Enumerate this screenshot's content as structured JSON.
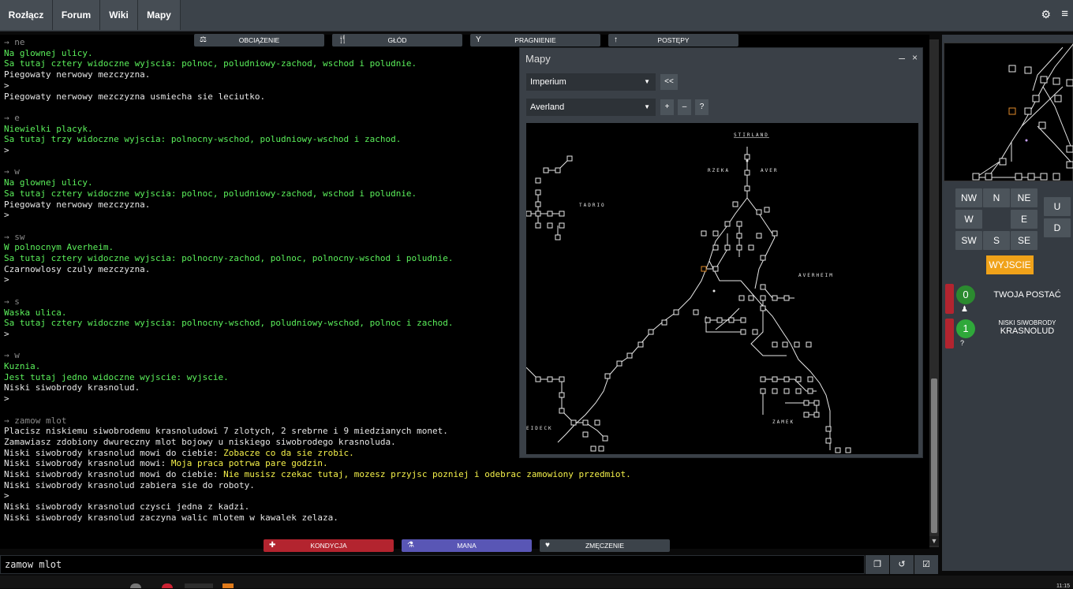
{
  "nav": {
    "disconnect": "Rozłącz",
    "forum": "Forum",
    "wiki": "Wiki",
    "maps": "Mapy"
  },
  "icons": {
    "settings": "gear-icon",
    "menu": "hamburger-icon"
  },
  "status_top": [
    {
      "label": "OBCIĄŻENIE",
      "icon": "scale-icon"
    },
    {
      "label": "GŁÓD",
      "icon": "fork-knife-icon"
    },
    {
      "label": "PRAGNIENIE",
      "icon": "cocktail-icon"
    },
    {
      "label": "POSTĘPY",
      "icon": "arrow-up-icon"
    }
  ],
  "status_bottom": [
    {
      "label": "KONDYCJA",
      "icon": "plus-icon",
      "color": "#b3242f"
    },
    {
      "label": "MANA",
      "icon": "flask-icon",
      "color": "#5956b5"
    },
    {
      "label": "ZMĘCZENIE",
      "icon": "heartbeat-icon",
      "color": "#3c434a"
    }
  ],
  "console_lines": [
    {
      "t": "→ ne",
      "c": "cmd"
    },
    {
      "t": "Na glownej ulicy.",
      "c": "grn"
    },
    {
      "t": "Sa tutaj cztery widoczne wyjscia: polnoc, poludniowy-zachod, wschod i poludnie.",
      "c": "grn"
    },
    {
      "t": "Piegowaty nerwowy mezczyzna.",
      "c": "wht"
    },
    {
      "t": ">",
      "c": "wht"
    },
    {
      "t": "Piegowaty nerwowy mezczyzna usmiecha sie leciutko.",
      "c": "wht"
    },
    {
      "t": "",
      "c": "wht"
    },
    {
      "t": "→ e",
      "c": "cmd"
    },
    {
      "t": "Niewielki placyk.",
      "c": "grn"
    },
    {
      "t": "Sa tutaj trzy widoczne wyjscia: polnocny-wschod, poludniowy-wschod i zachod.",
      "c": "grn"
    },
    {
      "t": ">",
      "c": "wht"
    },
    {
      "t": "",
      "c": "wht"
    },
    {
      "t": "→ w",
      "c": "cmd"
    },
    {
      "t": "Na glownej ulicy.",
      "c": "grn"
    },
    {
      "t": "Sa tutaj cztery widoczne wyjscia: polnoc, poludniowy-zachod, wschod i poludnie.",
      "c": "grn"
    },
    {
      "t": "Piegowaty nerwowy mezczyzna.",
      "c": "wht"
    },
    {
      "t": ">",
      "c": "wht"
    },
    {
      "t": "",
      "c": "wht"
    },
    {
      "t": "→ sw",
      "c": "cmd"
    },
    {
      "t": "W polnocnym Averheim.",
      "c": "grn"
    },
    {
      "t": "Sa tutaj cztery widoczne wyjscia: polnocny-zachod, polnoc, polnocny-wschod i poludnie.",
      "c": "grn"
    },
    {
      "t": "Czarnowlosy czuly mezczyzna.",
      "c": "wht"
    },
    {
      "t": ">",
      "c": "wht"
    },
    {
      "t": "",
      "c": "wht"
    },
    {
      "t": "→ s",
      "c": "cmd"
    },
    {
      "t": "Waska ulica.",
      "c": "grn"
    },
    {
      "t": "Sa tutaj cztery widoczne wyjscia: polnocny-wschod, poludniowy-wschod, polnoc i zachod.",
      "c": "grn"
    },
    {
      "t": ">",
      "c": "wht"
    },
    {
      "t": "",
      "c": "wht"
    },
    {
      "t": "→ w",
      "c": "cmd"
    },
    {
      "t": "Kuznia.",
      "c": "grn"
    },
    {
      "t": "Jest tutaj jedno widoczne wyjscie: wyjscie.",
      "c": "grn"
    },
    {
      "t": "Niski siwobrody krasnolud.",
      "c": "wht"
    },
    {
      "t": ">",
      "c": "wht"
    },
    {
      "t": "",
      "c": "wht"
    },
    {
      "t": "→ zamow mlot",
      "c": "cmd"
    },
    {
      "t": "Placisz niskiemu siwobrodemu krasnoludowi 7 zlotych, 2 srebrne i 9 miedzianych monet.",
      "c": "wht"
    },
    {
      "t": "Zamawiasz zdobiony dwureczny mlot bojowy u niskiego siwobrodego krasnoluda.",
      "c": "wht"
    },
    {
      "t": "Niski siwobrody krasnolud mowi do ciebie: ",
      "c": "wht",
      "y": "Zobacze co da sie zrobic."
    },
    {
      "t": "Niski siwobrody krasnolud mowi: ",
      "c": "wht",
      "y": "Moja praca potrwa pare godzin."
    },
    {
      "t": "Niski siwobrody krasnolud mowi do ciebie: ",
      "c": "wht",
      "y": "Nie musisz czekac tutaj, mozesz przyjsc pozniej i odebrac zamowiony przedmiot."
    },
    {
      "t": "Niski siwobrody krasnolud zabiera sie do roboty.",
      "c": "wht"
    },
    {
      "t": ">",
      "c": "wht"
    },
    {
      "t": "Niski siwobrody krasnolud czysci jedna z kadzi.",
      "c": "wht"
    },
    {
      "t": "Niski siwobrody krasnolud zaczyna walic mlotem w kawalek zelaza.",
      "c": "wht"
    }
  ],
  "map_window": {
    "title": "Mapy",
    "minimize": "–",
    "close": "×",
    "region_select": "Imperium",
    "area_select": "Averland",
    "back_btn": "<<",
    "zoom_in": "+",
    "zoom_out": "–",
    "help": "?",
    "labels": [
      "STIRLAND",
      "RZEKA",
      "AVER",
      "TADRIO",
      "AVERHEIM",
      "ZAMEK",
      "EIDECK"
    ]
  },
  "directions": {
    "nw": "NW",
    "n": "N",
    "ne": "NE",
    "w": "W",
    "e": "E",
    "sw": "SW",
    "s": "S",
    "se": "SE",
    "u": "U",
    "d": "D",
    "exit": "WYJSCIE"
  },
  "party": [
    {
      "number": "0",
      "label": "TWOJA POSTAĆ",
      "icon": "person-icon"
    },
    {
      "number": "1",
      "label_small": "NISKI SIWOBRODY",
      "label_big": "KRASNOLUD",
      "icon": "question-icon"
    }
  ],
  "input": {
    "value": "zamow mlot"
  },
  "input_buttons": [
    "copy-icon",
    "history-icon",
    "check-icon"
  ],
  "clock": "11:15"
}
